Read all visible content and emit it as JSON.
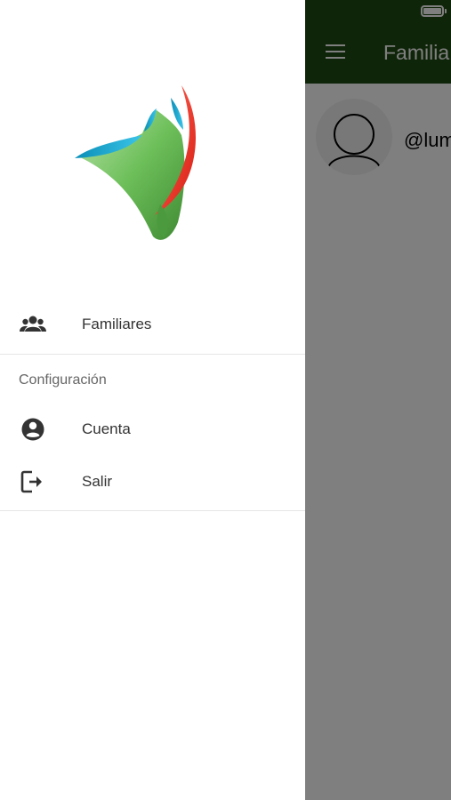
{
  "appbar": {
    "title": "Familia",
    "color": "#1f4a12"
  },
  "user": {
    "handle": "@lum"
  },
  "drawer": {
    "items": [
      {
        "label": "Familiares",
        "icon": "group-icon"
      }
    ],
    "section": {
      "title": "Configuración",
      "items": [
        {
          "label": "Cuenta",
          "icon": "account-circle-icon"
        },
        {
          "label": "Salir",
          "icon": "exit-icon"
        }
      ]
    }
  }
}
